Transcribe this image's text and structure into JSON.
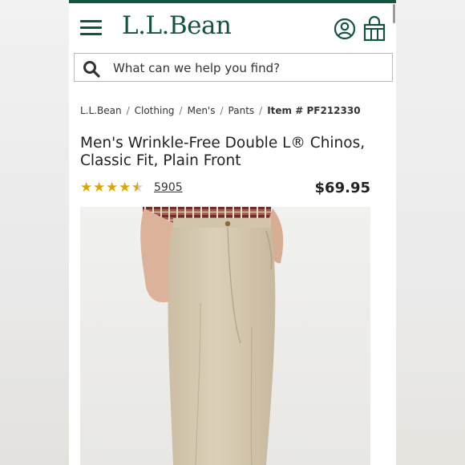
{
  "brand": {
    "logo_text": "L.L.Bean",
    "accent_color": "#12553b"
  },
  "header": {
    "menu_icon": "hamburger-menu-icon",
    "account_icon": "account-icon",
    "bag_icon": "shopping-bag-icon"
  },
  "search": {
    "placeholder": "What can we help you find?",
    "icon": "search-icon"
  },
  "breadcrumb": {
    "items": [
      "L.L.Bean",
      "Clothing",
      "Men's",
      "Pants"
    ],
    "separator": "/",
    "item_number": "Item # PF212330"
  },
  "product": {
    "title_line1": "Men's Wrinkle-Free Double L® Chinos,",
    "title_line2": "Classic Fit, Plain Front",
    "rating": 4.5,
    "review_count": "5905",
    "price": "$69.95",
    "image_alt": "Man wearing khaki chinos with plaid shirt",
    "colors": {
      "pants": "#d8ccb4",
      "shirt": "#9b4b3c",
      "star": "#e2a400"
    }
  }
}
